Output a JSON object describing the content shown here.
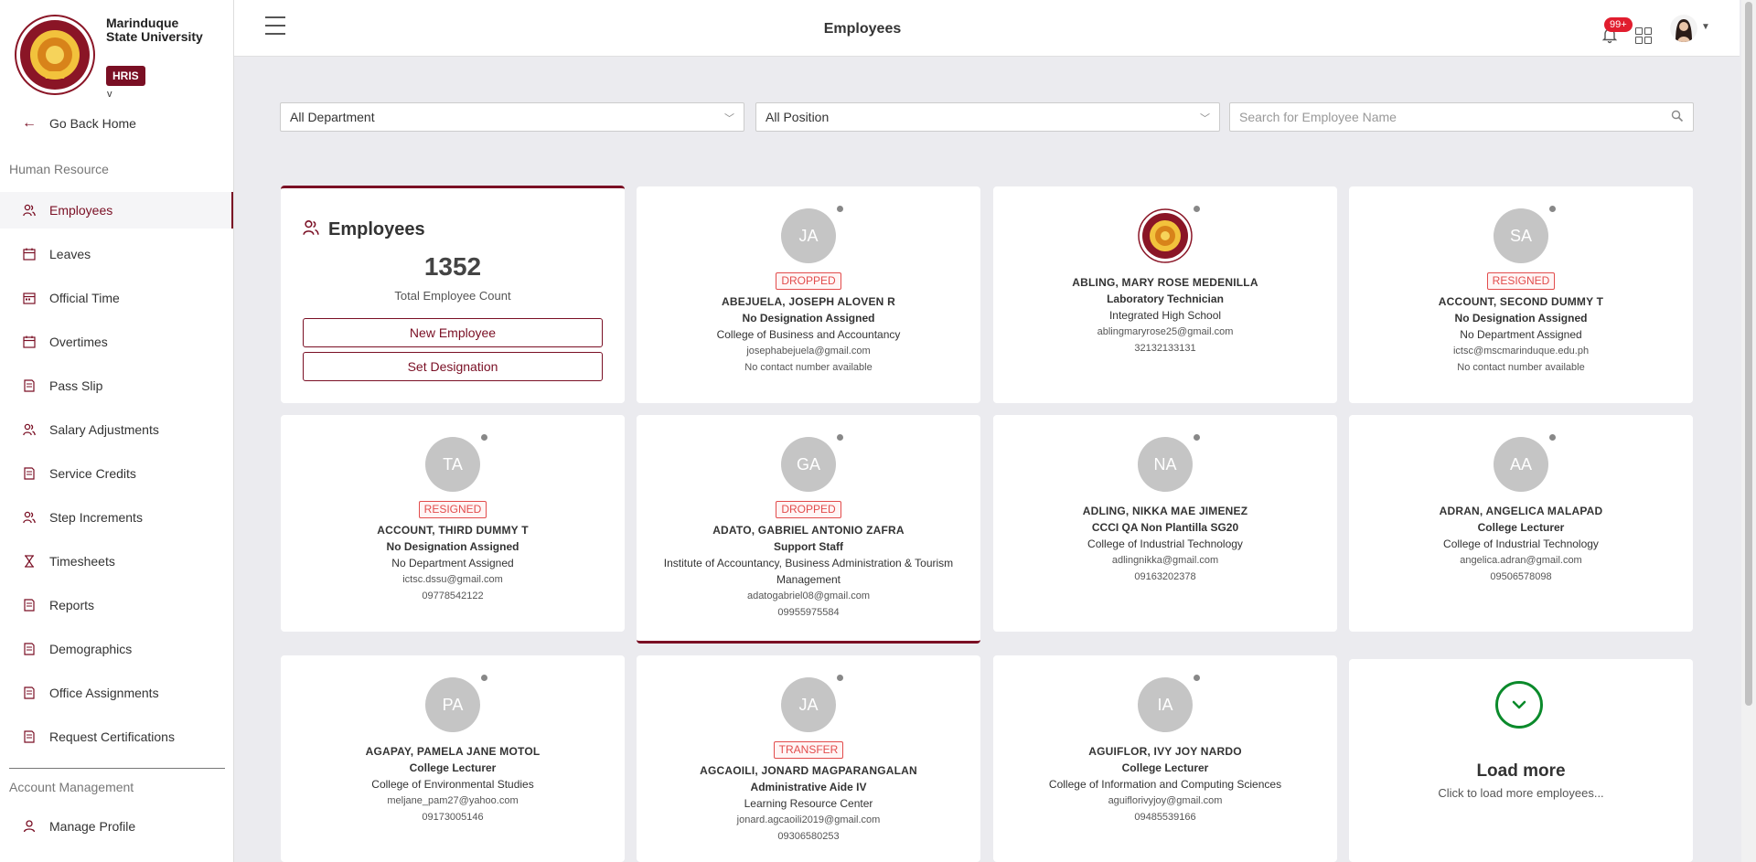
{
  "brand": {
    "university": "Marinduque State University",
    "badge": "HRIS",
    "version": "v"
  },
  "sidebar": {
    "go_home": "Go Back Home",
    "section_hr": "Human Resource",
    "items": [
      {
        "label": "Employees",
        "icon": "users-icon"
      },
      {
        "label": "Leaves",
        "icon": "calendar-icon"
      },
      {
        "label": "Official Time",
        "icon": "calendar-clock-icon"
      },
      {
        "label": "Overtimes",
        "icon": "calendar-icon"
      },
      {
        "label": "Pass Slip",
        "icon": "document-icon"
      },
      {
        "label": "Salary Adjustments",
        "icon": "users-icon"
      },
      {
        "label": "Service Credits",
        "icon": "document-icon"
      },
      {
        "label": "Step Increments",
        "icon": "users-icon"
      },
      {
        "label": "Timesheets",
        "icon": "hourglass-icon"
      },
      {
        "label": "Reports",
        "icon": "document-icon"
      },
      {
        "label": "Demographics",
        "icon": "document-icon"
      },
      {
        "label": "Office Assignments",
        "icon": "document-icon"
      },
      {
        "label": "Request Certifications",
        "icon": "document-icon"
      }
    ],
    "section_account": "Account Management",
    "manage_profile": "Manage Profile"
  },
  "header": {
    "title": "Employees",
    "notification_count": "99+"
  },
  "filters": {
    "department": "All Department",
    "position": "All Position",
    "search_placeholder": "Search for Employee Name"
  },
  "summary": {
    "title": "Employees",
    "count": "1352",
    "subtitle": "Total Employee Count",
    "new_button": "New Employee",
    "designation_button": "Set Designation"
  },
  "employees": [
    {
      "initials": "JA",
      "status": "DROPPED",
      "name": "ABEJUELA, JOSEPH ALOVEN R",
      "designation": "No Designation Assigned",
      "department": "College of Business and Accountancy",
      "email": "josephabejuela@gmail.com",
      "phone": "No contact number available"
    },
    {
      "initials": "",
      "status": "",
      "name": "ABLING, MARY ROSE MEDENILLA",
      "designation": "Laboratory Technician",
      "department": "Integrated High School",
      "email": "ablingmaryrose25@gmail.com",
      "phone": "32132133131"
    },
    {
      "initials": "SA",
      "status": "RESIGNED",
      "name": "ACCOUNT, SECOND DUMMY T",
      "designation": "No Designation Assigned",
      "department": "No Department Assigned",
      "email": "ictsc@mscmarinduque.edu.ph",
      "phone": "No contact number available"
    },
    {
      "initials": "TA",
      "status": "RESIGNED",
      "name": "ACCOUNT, THIRD DUMMY T",
      "designation": "No Designation Assigned",
      "department": "No Department Assigned",
      "email": "ictsc.dssu@gmail.com",
      "phone": "09778542122"
    },
    {
      "initials": "GA",
      "status": "DROPPED",
      "name": "ADATO, GABRIEL ANTONIO ZAFRA",
      "designation": "Support Staff",
      "department": "Institute of Accountancy, Business Administration & Tourism Management",
      "email": "adatogabriel08@gmail.com",
      "phone": "09955975584"
    },
    {
      "initials": "NA",
      "status": "",
      "name": "ADLING, NIKKA MAE JIMENEZ",
      "designation": "CCCI QA Non Plantilla SG20",
      "department": "College of Industrial Technology",
      "email": "adlingnikka@gmail.com",
      "phone": "09163202378"
    },
    {
      "initials": "AA",
      "status": "",
      "name": "ADRAN, ANGELICA MALAPAD",
      "designation": "College Lecturer",
      "department": "College of Industrial Technology",
      "email": "angelica.adran@gmail.com",
      "phone": "09506578098"
    },
    {
      "initials": "PA",
      "status": "",
      "name": "AGAPAY, PAMELA JANE MOTOL",
      "designation": "College Lecturer",
      "department": "College of Environmental Studies",
      "email": "meljane_pam27@yahoo.com",
      "phone": "09173005146"
    },
    {
      "initials": "JA",
      "status": "TRANSFER",
      "name": "AGCAOILI, JONARD MAGPARANGALAN",
      "designation": "Administrative Aide IV",
      "department": "Learning Resource Center",
      "email": "jonard.agcaoili2019@gmail.com",
      "phone": "09306580253"
    },
    {
      "initials": "IA",
      "status": "",
      "name": "AGUIFLOR, IVY JOY NARDO",
      "designation": "College Lecturer",
      "department": "College of Information and Computing Sciences",
      "email": "aguiflorivyjoy@gmail.com",
      "phone": "09485539166"
    }
  ],
  "load_more": {
    "title": "Load more",
    "subtitle": "Click to load more employees..."
  }
}
